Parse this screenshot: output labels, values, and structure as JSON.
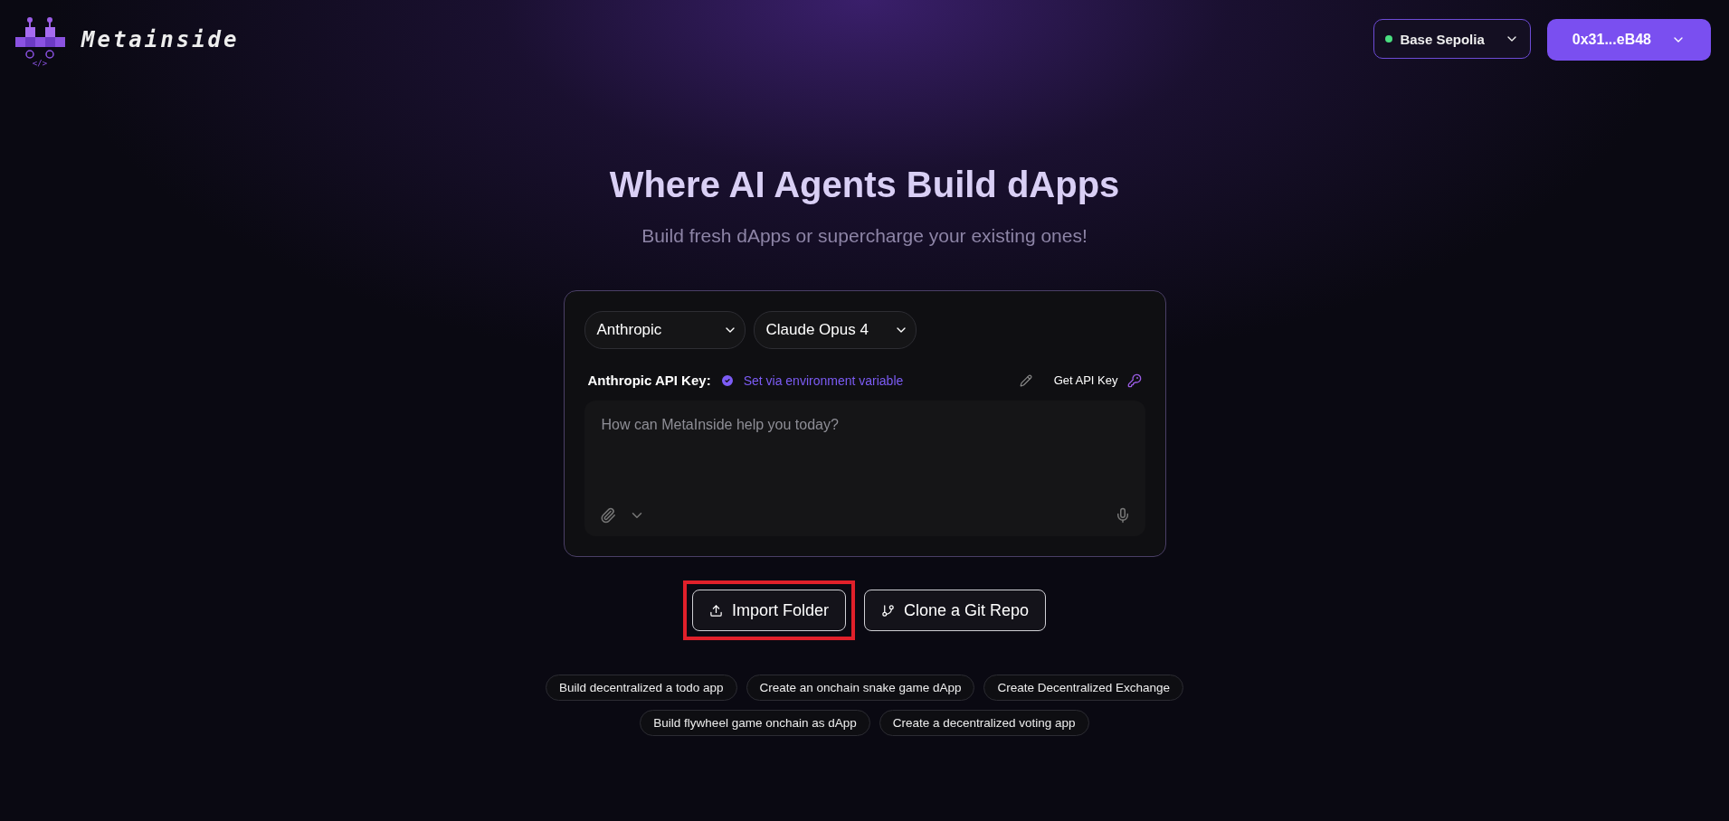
{
  "header": {
    "logo_text": "Metainside",
    "logo_code": "</>",
    "network": {
      "label": "Base Sepolia",
      "color": "#4ade80"
    },
    "wallet": {
      "label": "0x31...eB48"
    }
  },
  "hero": {
    "title": "Where AI Agents Build dApps",
    "subtitle": "Build fresh dApps or supercharge your existing ones!"
  },
  "composer": {
    "provider": "Anthropic",
    "model": "Claude Opus 4",
    "api_key_label": "Anthropic API Key:",
    "api_key_status": "Set via environment variable",
    "api_key_set": true,
    "get_key": "Get API Key",
    "placeholder": "How can MetaInside help you today?"
  },
  "actions": [
    {
      "label": "Import Folder",
      "kind": "upload",
      "highlighted": true
    },
    {
      "label": "Clone a Git Repo",
      "kind": "git",
      "highlighted": false
    }
  ],
  "suggestions": [
    [
      "Build decentralized a todo app",
      "Create an onchain snake game dApp",
      "Create Decentralized Exchange"
    ],
    [
      "Build flywheel game onchain as dApp",
      "Create a decentralized voting app"
    ]
  ]
}
